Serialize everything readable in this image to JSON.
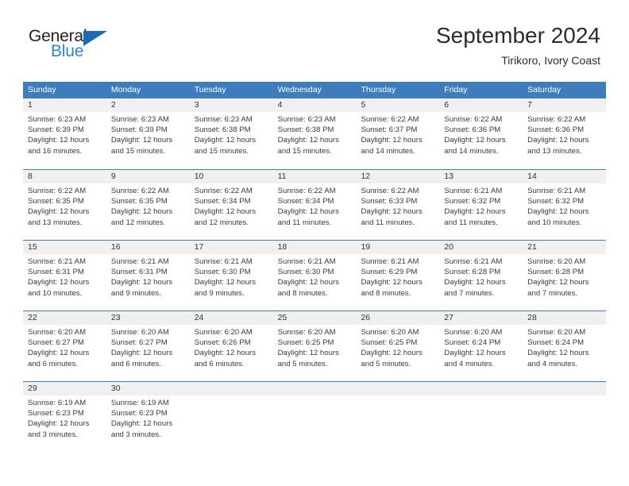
{
  "logo": {
    "word_top": "General",
    "word_bottom": "Blue",
    "triangle_color": "#1a6bb5",
    "blue_color": "#2b84d6"
  },
  "header": {
    "title": "September 2024",
    "subtitle": "Tirikoro, Ivory Coast"
  },
  "theme": {
    "header_row_bg": "#3d7cbd",
    "day_strip_bg": "#f0f0f0",
    "week_separator": "#3d7cbd"
  },
  "weekdays": [
    "Sunday",
    "Monday",
    "Tuesday",
    "Wednesday",
    "Thursday",
    "Friday",
    "Saturday"
  ],
  "weeks": [
    [
      {
        "day": "1",
        "sunrise": "Sunrise: 6:23 AM",
        "sunset": "Sunset: 6:39 PM",
        "daylight_line1": "Daylight: 12 hours",
        "daylight_line2": "and 16 minutes."
      },
      {
        "day": "2",
        "sunrise": "Sunrise: 6:23 AM",
        "sunset": "Sunset: 6:39 PM",
        "daylight_line1": "Daylight: 12 hours",
        "daylight_line2": "and 15 minutes."
      },
      {
        "day": "3",
        "sunrise": "Sunrise: 6:23 AM",
        "sunset": "Sunset: 6:38 PM",
        "daylight_line1": "Daylight: 12 hours",
        "daylight_line2": "and 15 minutes."
      },
      {
        "day": "4",
        "sunrise": "Sunrise: 6:23 AM",
        "sunset": "Sunset: 6:38 PM",
        "daylight_line1": "Daylight: 12 hours",
        "daylight_line2": "and 15 minutes."
      },
      {
        "day": "5",
        "sunrise": "Sunrise: 6:22 AM",
        "sunset": "Sunset: 6:37 PM",
        "daylight_line1": "Daylight: 12 hours",
        "daylight_line2": "and 14 minutes."
      },
      {
        "day": "6",
        "sunrise": "Sunrise: 6:22 AM",
        "sunset": "Sunset: 6:36 PM",
        "daylight_line1": "Daylight: 12 hours",
        "daylight_line2": "and 14 minutes."
      },
      {
        "day": "7",
        "sunrise": "Sunrise: 6:22 AM",
        "sunset": "Sunset: 6:36 PM",
        "daylight_line1": "Daylight: 12 hours",
        "daylight_line2": "and 13 minutes."
      }
    ],
    [
      {
        "day": "8",
        "sunrise": "Sunrise: 6:22 AM",
        "sunset": "Sunset: 6:35 PM",
        "daylight_line1": "Daylight: 12 hours",
        "daylight_line2": "and 13 minutes."
      },
      {
        "day": "9",
        "sunrise": "Sunrise: 6:22 AM",
        "sunset": "Sunset: 6:35 PM",
        "daylight_line1": "Daylight: 12 hours",
        "daylight_line2": "and 12 minutes."
      },
      {
        "day": "10",
        "sunrise": "Sunrise: 6:22 AM",
        "sunset": "Sunset: 6:34 PM",
        "daylight_line1": "Daylight: 12 hours",
        "daylight_line2": "and 12 minutes."
      },
      {
        "day": "11",
        "sunrise": "Sunrise: 6:22 AM",
        "sunset": "Sunset: 6:34 PM",
        "daylight_line1": "Daylight: 12 hours",
        "daylight_line2": "and 11 minutes."
      },
      {
        "day": "12",
        "sunrise": "Sunrise: 6:22 AM",
        "sunset": "Sunset: 6:33 PM",
        "daylight_line1": "Daylight: 12 hours",
        "daylight_line2": "and 11 minutes."
      },
      {
        "day": "13",
        "sunrise": "Sunrise: 6:21 AM",
        "sunset": "Sunset: 6:32 PM",
        "daylight_line1": "Daylight: 12 hours",
        "daylight_line2": "and 11 minutes."
      },
      {
        "day": "14",
        "sunrise": "Sunrise: 6:21 AM",
        "sunset": "Sunset: 6:32 PM",
        "daylight_line1": "Daylight: 12 hours",
        "daylight_line2": "and 10 minutes."
      }
    ],
    [
      {
        "day": "15",
        "sunrise": "Sunrise: 6:21 AM",
        "sunset": "Sunset: 6:31 PM",
        "daylight_line1": "Daylight: 12 hours",
        "daylight_line2": "and 10 minutes."
      },
      {
        "day": "16",
        "sunrise": "Sunrise: 6:21 AM",
        "sunset": "Sunset: 6:31 PM",
        "daylight_line1": "Daylight: 12 hours",
        "daylight_line2": "and 9 minutes."
      },
      {
        "day": "17",
        "sunrise": "Sunrise: 6:21 AM",
        "sunset": "Sunset: 6:30 PM",
        "daylight_line1": "Daylight: 12 hours",
        "daylight_line2": "and 9 minutes."
      },
      {
        "day": "18",
        "sunrise": "Sunrise: 6:21 AM",
        "sunset": "Sunset: 6:30 PM",
        "daylight_line1": "Daylight: 12 hours",
        "daylight_line2": "and 8 minutes."
      },
      {
        "day": "19",
        "sunrise": "Sunrise: 6:21 AM",
        "sunset": "Sunset: 6:29 PM",
        "daylight_line1": "Daylight: 12 hours",
        "daylight_line2": "and 8 minutes."
      },
      {
        "day": "20",
        "sunrise": "Sunrise: 6:21 AM",
        "sunset": "Sunset: 6:28 PM",
        "daylight_line1": "Daylight: 12 hours",
        "daylight_line2": "and 7 minutes."
      },
      {
        "day": "21",
        "sunrise": "Sunrise: 6:20 AM",
        "sunset": "Sunset: 6:28 PM",
        "daylight_line1": "Daylight: 12 hours",
        "daylight_line2": "and 7 minutes."
      }
    ],
    [
      {
        "day": "22",
        "sunrise": "Sunrise: 6:20 AM",
        "sunset": "Sunset: 6:27 PM",
        "daylight_line1": "Daylight: 12 hours",
        "daylight_line2": "and 6 minutes."
      },
      {
        "day": "23",
        "sunrise": "Sunrise: 6:20 AM",
        "sunset": "Sunset: 6:27 PM",
        "daylight_line1": "Daylight: 12 hours",
        "daylight_line2": "and 6 minutes."
      },
      {
        "day": "24",
        "sunrise": "Sunrise: 6:20 AM",
        "sunset": "Sunset: 6:26 PM",
        "daylight_line1": "Daylight: 12 hours",
        "daylight_line2": "and 6 minutes."
      },
      {
        "day": "25",
        "sunrise": "Sunrise: 6:20 AM",
        "sunset": "Sunset: 6:25 PM",
        "daylight_line1": "Daylight: 12 hours",
        "daylight_line2": "and 5 minutes."
      },
      {
        "day": "26",
        "sunrise": "Sunrise: 6:20 AM",
        "sunset": "Sunset: 6:25 PM",
        "daylight_line1": "Daylight: 12 hours",
        "daylight_line2": "and 5 minutes."
      },
      {
        "day": "27",
        "sunrise": "Sunrise: 6:20 AM",
        "sunset": "Sunset: 6:24 PM",
        "daylight_line1": "Daylight: 12 hours",
        "daylight_line2": "and 4 minutes."
      },
      {
        "day": "28",
        "sunrise": "Sunrise: 6:20 AM",
        "sunset": "Sunset: 6:24 PM",
        "daylight_line1": "Daylight: 12 hours",
        "daylight_line2": "and 4 minutes."
      }
    ],
    [
      {
        "day": "29",
        "sunrise": "Sunrise: 6:19 AM",
        "sunset": "Sunset: 6:23 PM",
        "daylight_line1": "Daylight: 12 hours",
        "daylight_line2": "and 3 minutes."
      },
      {
        "day": "30",
        "sunrise": "Sunrise: 6:19 AM",
        "sunset": "Sunset: 6:23 PM",
        "daylight_line1": "Daylight: 12 hours",
        "daylight_line2": "and 3 minutes."
      },
      {
        "day": "",
        "sunrise": "",
        "sunset": "",
        "daylight_line1": "",
        "daylight_line2": ""
      },
      {
        "day": "",
        "sunrise": "",
        "sunset": "",
        "daylight_line1": "",
        "daylight_line2": ""
      },
      {
        "day": "",
        "sunrise": "",
        "sunset": "",
        "daylight_line1": "",
        "daylight_line2": ""
      },
      {
        "day": "",
        "sunrise": "",
        "sunset": "",
        "daylight_line1": "",
        "daylight_line2": ""
      },
      {
        "day": "",
        "sunrise": "",
        "sunset": "",
        "daylight_line1": "",
        "daylight_line2": ""
      }
    ]
  ]
}
